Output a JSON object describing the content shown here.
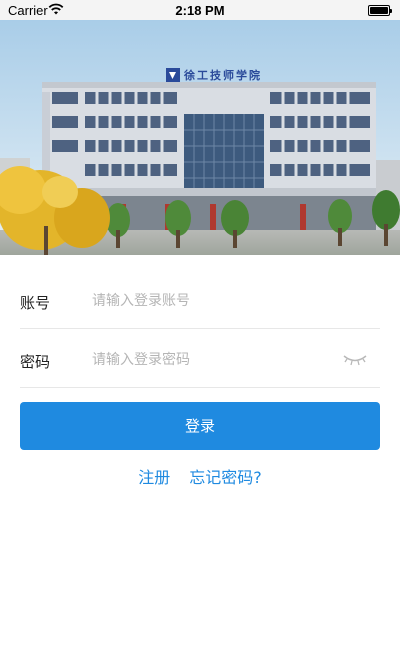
{
  "status_bar": {
    "carrier": "Carrier",
    "time": "2:18 PM"
  },
  "banner": {
    "sign_text": "徐工技师学院"
  },
  "form": {
    "account_label": "账号",
    "account_placeholder": "请输入登录账号",
    "account_value": "",
    "password_label": "密码",
    "password_placeholder": "请输入登录密码",
    "password_value": ""
  },
  "login_button_label": "登录",
  "links": {
    "register": "注册",
    "forgot_password": "忘记密码?"
  },
  "colors": {
    "primary": "#1f8ae0",
    "divider": "#e7e7e7",
    "placeholder": "#b5b5b5"
  },
  "icons": {
    "wifi": "wifi-icon",
    "battery": "battery-icon",
    "password_toggle": "eye-closed-icon"
  }
}
